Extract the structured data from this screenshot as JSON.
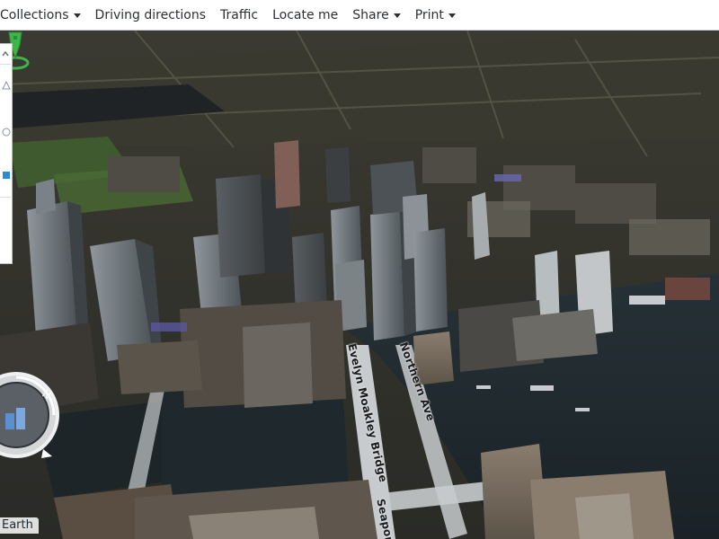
{
  "toolbar": {
    "items": [
      {
        "label": "Collections",
        "has_dropdown": true
      },
      {
        "label": "Driving directions",
        "has_dropdown": false
      },
      {
        "label": "Traffic",
        "has_dropdown": false
      },
      {
        "label": "Locate me",
        "has_dropdown": false
      },
      {
        "label": "Share",
        "has_dropdown": true
      },
      {
        "label": "Print",
        "has_dropdown": true
      }
    ]
  },
  "map": {
    "streets": [
      {
        "label": "Evelyn Moakley Bridge"
      },
      {
        "label": "Northern Ave"
      },
      {
        "label": "Seaport"
      }
    ],
    "earth_label": "Earth",
    "compass_letter": "N"
  },
  "colors": {
    "pin_green": "#3fb44a",
    "water": "#1f272c",
    "road": "#c9ccce"
  }
}
